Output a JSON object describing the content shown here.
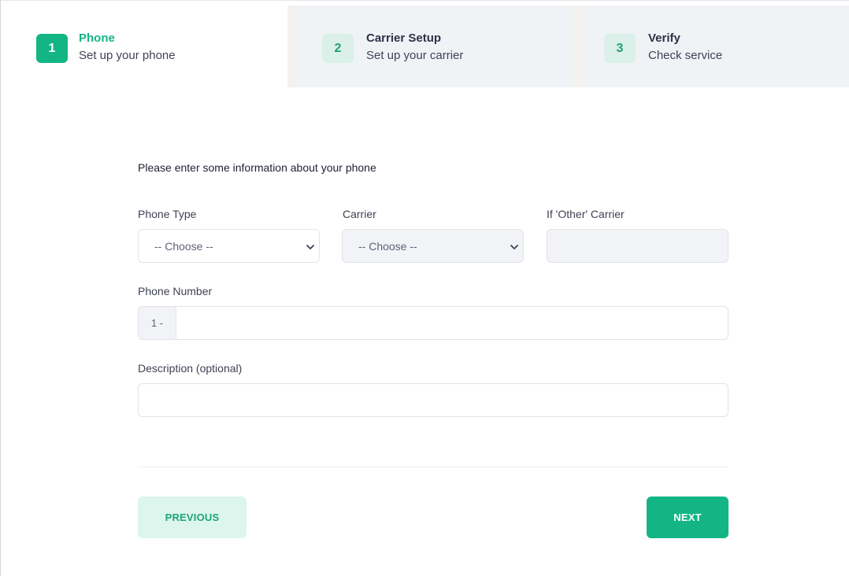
{
  "stepper": {
    "steps": [
      {
        "number": "1",
        "title": "Phone",
        "subtitle": "Set up your phone",
        "state": "active"
      },
      {
        "number": "2",
        "title": "Carrier Setup",
        "subtitle": "Set up your carrier",
        "state": "pending"
      },
      {
        "number": "3",
        "title": "Verify",
        "subtitle": "Check service",
        "state": "pending"
      }
    ]
  },
  "form": {
    "intro": "Please enter some information about your phone",
    "phone_type": {
      "label": "Phone Type",
      "value": "-- Choose --"
    },
    "carrier": {
      "label": "Carrier",
      "value": "-- Choose --"
    },
    "other_carrier": {
      "label": "If 'Other' Carrier",
      "value": ""
    },
    "phone_number": {
      "label": "Phone Number",
      "prefix": "1 -",
      "value": ""
    },
    "description": {
      "label": "Description (optional)",
      "value": ""
    }
  },
  "actions": {
    "previous_label": "PREVIOUS",
    "next_label": "NEXT"
  },
  "colors": {
    "accent": "#13b584",
    "accent_light": "#dcf6ee",
    "step_inactive_bg": "#f0f3f6"
  },
  "icons": {
    "select_arrow": "chevron-down-icon"
  }
}
